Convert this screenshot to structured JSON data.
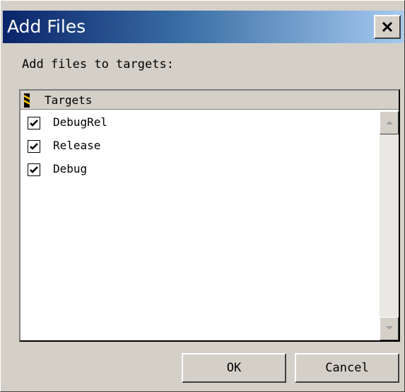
{
  "window": {
    "title": "Add Files",
    "close_icon": "close-icon"
  },
  "prompt": "Add files to targets:",
  "targets_list": {
    "header": "Targets",
    "header_icon": "target-marker-icon",
    "items": [
      {
        "label": "DebugRel",
        "checked": true
      },
      {
        "label": "Release",
        "checked": true
      },
      {
        "label": "Debug",
        "checked": true
      }
    ]
  },
  "buttons": {
    "ok": "OK",
    "cancel": "Cancel"
  },
  "colors": {
    "title_gradient_start": "#0a246a",
    "title_gradient_end": "#a6caf0",
    "face": "#d4d0c8"
  }
}
